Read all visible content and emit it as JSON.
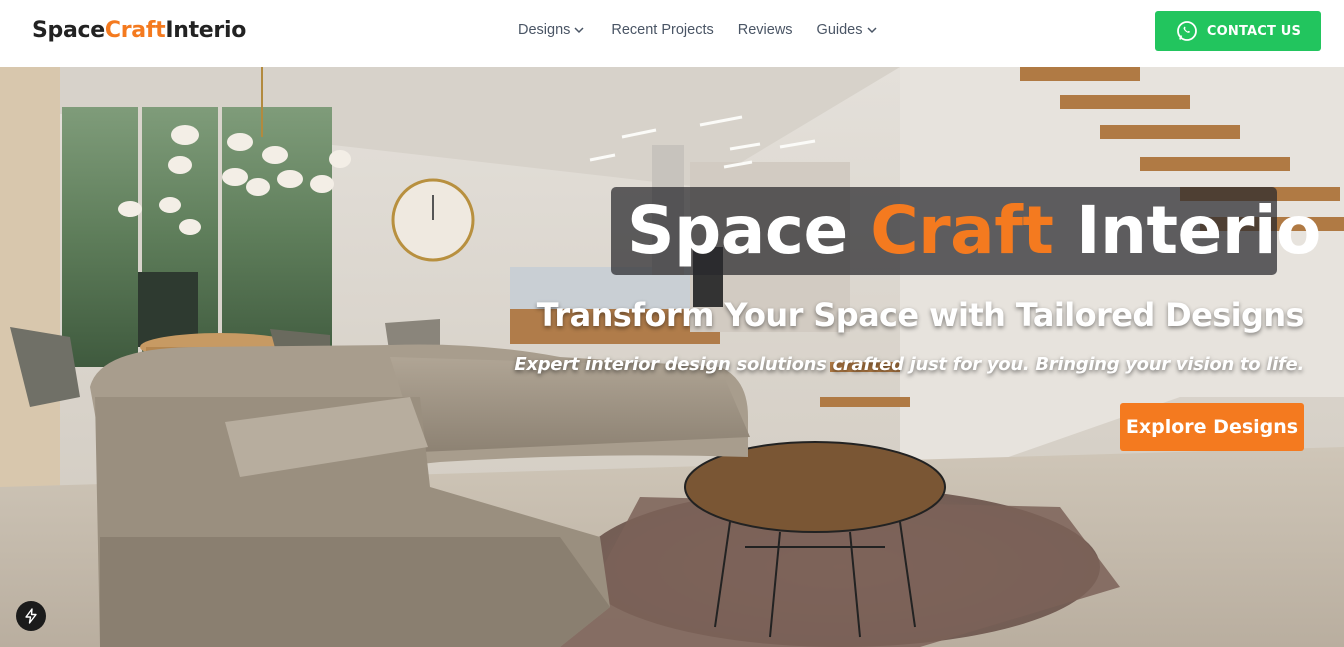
{
  "header": {
    "logo": {
      "part1": "Space",
      "part2": "Craft",
      "part3": "Interio"
    },
    "nav": [
      {
        "label": "Designs",
        "has_dropdown": true
      },
      {
        "label": "Recent Projects",
        "has_dropdown": false
      },
      {
        "label": "Reviews",
        "has_dropdown": false
      },
      {
        "label": "Guides",
        "has_dropdown": true
      }
    ],
    "contact_button": {
      "label": "CONTACT US",
      "icon": "whatsapp-icon"
    }
  },
  "hero": {
    "title": {
      "part1": "Space ",
      "part2": "Craft",
      "part3": " Interio"
    },
    "subtitle": "Transform Your Space with Tailored Designs",
    "tagline": "Expert interior design solutions crafted just for you. Bringing your vision to life.",
    "cta_label": "Explore Designs",
    "background": "living-room-photo"
  },
  "floating_badge": {
    "icon": "lightning-bolt-icon"
  },
  "colors": {
    "accent": "#f47a1f",
    "contact_green": "#22c55e",
    "nav_text": "#4a5565",
    "title_box": "#28282c"
  }
}
